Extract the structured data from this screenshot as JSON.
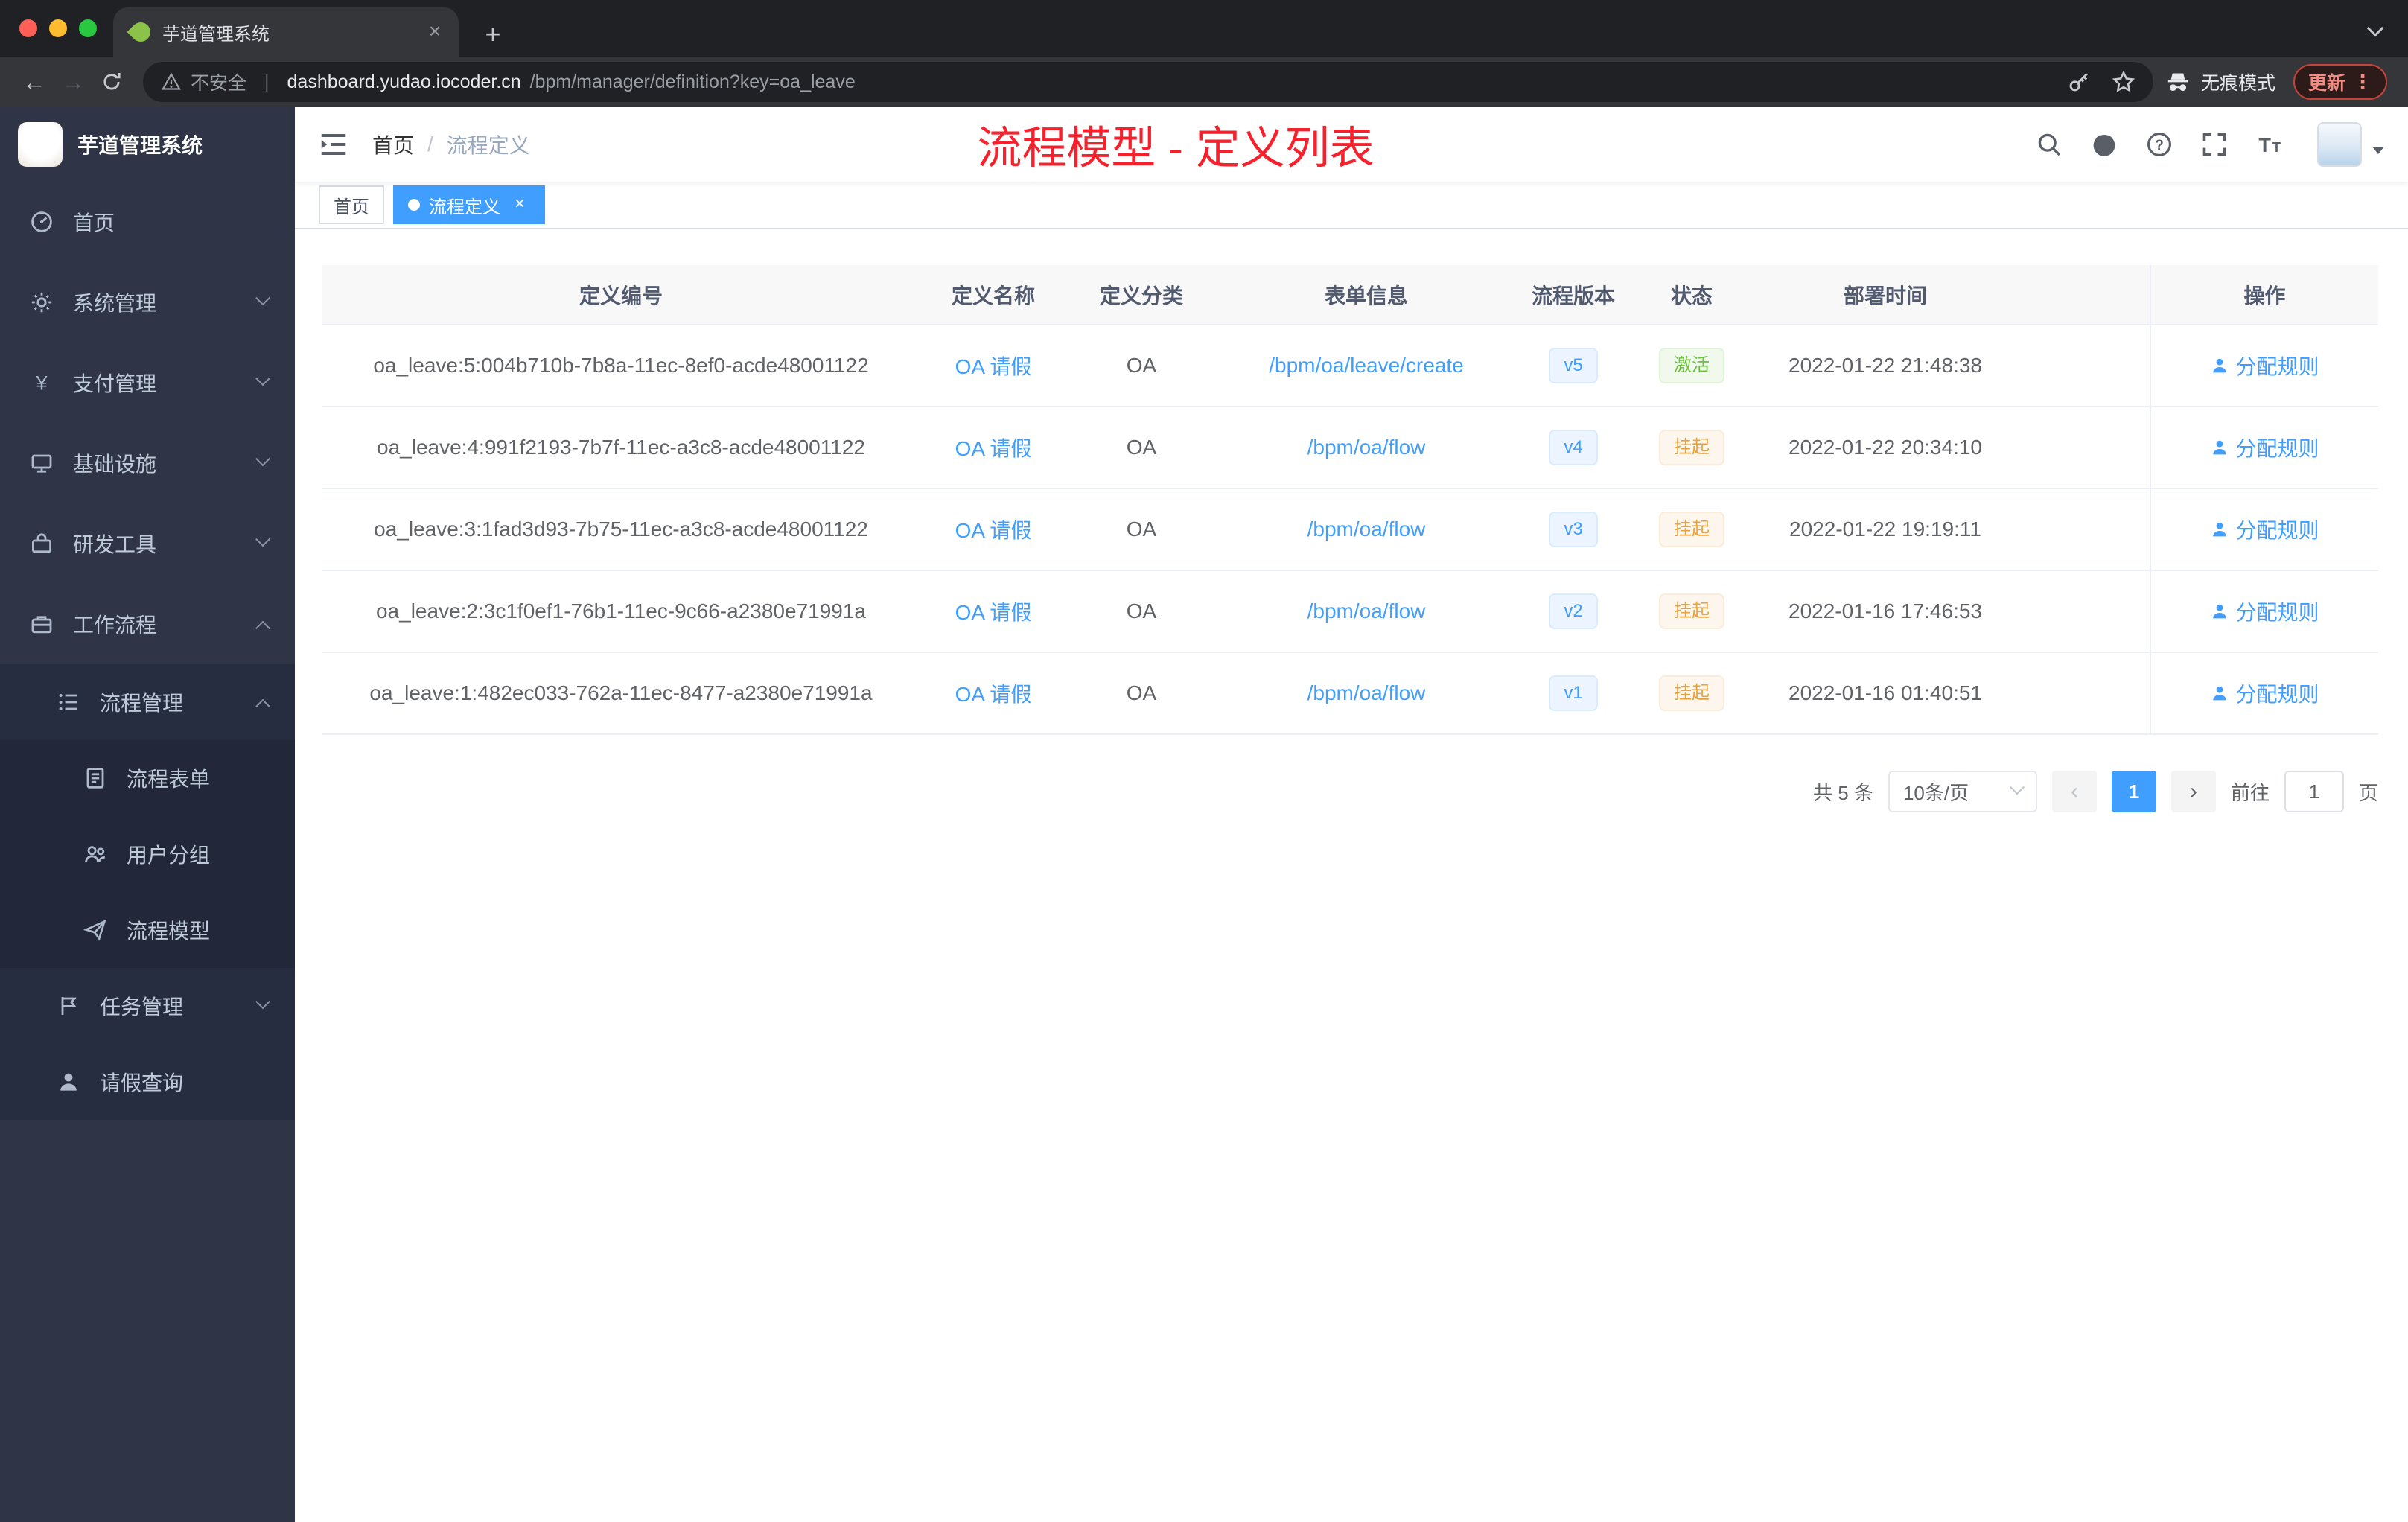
{
  "browser": {
    "tab": {
      "title": "芋道管理系统",
      "close_glyph": "×"
    },
    "new_tab_glyph": "+",
    "toolbar": {
      "back_glyph": "←",
      "forward_glyph": "→",
      "security_label": "不安全",
      "url_host": "dashboard.yudao.iocoder.cn",
      "url_path": "/bpm/manager/definition?key=oa_leave",
      "incognito_label": "无痕模式",
      "update_label": "更新",
      "menu_glyph": "⋮"
    }
  },
  "sidebar": {
    "logo_title": "芋道管理系统",
    "menu": [
      {
        "key": "home",
        "label": "首页",
        "icon": "dashboard-icon",
        "level": 1
      },
      {
        "key": "system-manage",
        "label": "系统管理",
        "icon": "gear-icon",
        "level": 1,
        "arrow": "down"
      },
      {
        "key": "payment-manage",
        "label": "支付管理",
        "icon": "yen-icon",
        "level": 1,
        "arrow": "down"
      },
      {
        "key": "infrastructure",
        "label": "基础设施",
        "icon": "infra-icon",
        "level": 1,
        "arrow": "down"
      },
      {
        "key": "dev-tools",
        "label": "研发工具",
        "icon": "tools-icon",
        "level": 1,
        "arrow": "down"
      },
      {
        "key": "workflow",
        "label": "工作流程",
        "icon": "workflow-icon",
        "level": 1,
        "arrow": "up"
      },
      {
        "key": "process-manage",
        "label": "流程管理",
        "icon": "flow-manage-icon",
        "level": 2,
        "arrow": "up"
      },
      {
        "key": "process-form",
        "label": "流程表单",
        "icon": "form-icon",
        "level": 3
      },
      {
        "key": "user-group",
        "label": "用户分组",
        "icon": "users-icon",
        "level": 3
      },
      {
        "key": "process-model",
        "label": "流程模型",
        "icon": "send-icon",
        "level": 3
      },
      {
        "key": "task-manage",
        "label": "任务管理",
        "icon": "task-icon",
        "level": 2,
        "arrow": "down"
      },
      {
        "key": "leave-query",
        "label": "请假查询",
        "icon": "user-icon",
        "level": 2
      }
    ]
  },
  "navbar": {
    "breadcrumb": {
      "home": "首页",
      "separator": "/",
      "current": "流程定义"
    },
    "overlay_title": "流程模型 - 定义列表"
  },
  "tags": [
    {
      "label": "首页",
      "active": false,
      "closable": false
    },
    {
      "label": "流程定义",
      "active": true,
      "closable": true,
      "close_glyph": "×"
    }
  ],
  "table": {
    "columns": [
      {
        "key": "id",
        "label": "定义编号"
      },
      {
        "key": "name",
        "label": "定义名称"
      },
      {
        "key": "category",
        "label": "定义分类"
      },
      {
        "key": "form",
        "label": "表单信息"
      },
      {
        "key": "version",
        "label": "流程版本"
      },
      {
        "key": "status",
        "label": "状态"
      },
      {
        "key": "deploy-time",
        "label": "部署时间"
      },
      {
        "key": "filler",
        "label": ""
      },
      {
        "key": "actions",
        "label": "操作"
      }
    ],
    "rows": [
      {
        "id": "oa_leave:5:004b710b-7b8a-11ec-8ef0-acde48001122",
        "name": "OA 请假",
        "category": "OA",
        "form": "/bpm/oa/leave/create",
        "version": "v5",
        "status": "激活",
        "status_type": "success",
        "deploy_time": "2022-01-22 21:48:38",
        "action": "分配规则"
      },
      {
        "id": "oa_leave:4:991f2193-7b7f-11ec-a3c8-acde48001122",
        "name": "OA 请假",
        "category": "OA",
        "form": "/bpm/oa/flow",
        "version": "v4",
        "status": "挂起",
        "status_type": "warning",
        "deploy_time": "2022-01-22 20:34:10",
        "action": "分配规则"
      },
      {
        "id": "oa_leave:3:1fad3d93-7b75-11ec-a3c8-acde48001122",
        "name": "OA 请假",
        "category": "OA",
        "form": "/bpm/oa/flow",
        "version": "v3",
        "status": "挂起",
        "status_type": "warning",
        "deploy_time": "2022-01-22 19:19:11",
        "action": "分配规则"
      },
      {
        "id": "oa_leave:2:3c1f0ef1-76b1-11ec-9c66-a2380e71991a",
        "name": "OA 请假",
        "category": "OA",
        "form": "/bpm/oa/flow",
        "version": "v2",
        "status": "挂起",
        "status_type": "warning",
        "deploy_time": "2022-01-16 17:46:53",
        "action": "分配规则"
      },
      {
        "id": "oa_leave:1:482ec033-762a-11ec-8477-a2380e71991a",
        "name": "OA 请假",
        "category": "OA",
        "form": "/bpm/oa/flow",
        "version": "v1",
        "status": "挂起",
        "status_type": "warning",
        "deploy_time": "2022-01-16 01:40:51",
        "action": "分配规则"
      }
    ]
  },
  "pagination": {
    "total_label": "共 5 条",
    "page_size_label": "10条/页",
    "prev_glyph": "‹",
    "current_page": "1",
    "next_glyph": "›",
    "goto_prefix": "前往",
    "goto_value": "1",
    "goto_suffix": "页"
  },
  "colors": {
    "accent_blue": "#409eff",
    "success_green": "#67c23a",
    "warning_orange": "#e6a23c",
    "overlay_red": "#f5222d",
    "sidebar_bg": "#2f3447",
    "submenu_bg": "#272d40",
    "active_tag_bg": "#409eff"
  }
}
